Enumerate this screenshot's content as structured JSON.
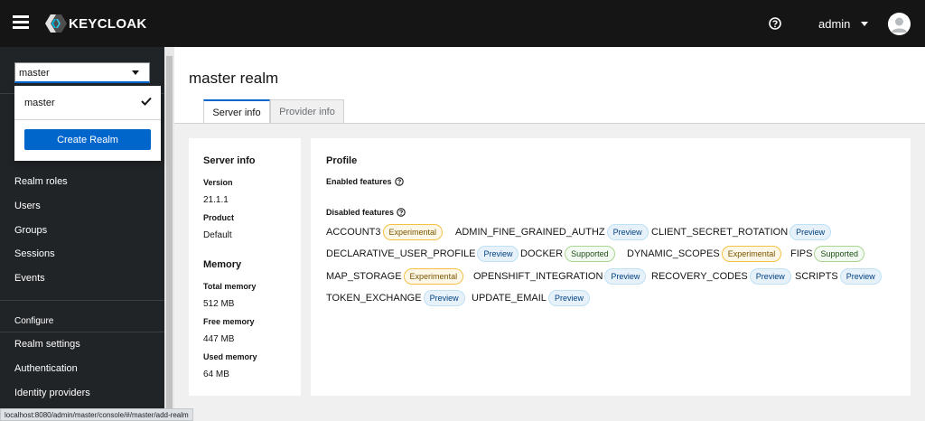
{
  "topbar": {
    "brand": "KEYCLOAK",
    "user_name": "admin",
    "icons": [
      "hamburger-icon",
      "keycloak-logo-icon",
      "help-icon",
      "caret-down-icon",
      "avatar-icon"
    ]
  },
  "realm_selector": {
    "value": "master",
    "options": [
      {
        "label": "master",
        "selected": true
      }
    ],
    "create_label": "Create Realm"
  },
  "sidebar": {
    "items": [
      {
        "label": "Realm roles"
      },
      {
        "label": "Users"
      },
      {
        "label": "Groups"
      },
      {
        "label": "Sessions"
      },
      {
        "label": "Events"
      }
    ],
    "section": "Configure",
    "config_items": [
      {
        "label": "Realm settings"
      },
      {
        "label": "Authentication"
      },
      {
        "label": "Identity providers"
      }
    ]
  },
  "page": {
    "title": "master realm",
    "tabs": [
      {
        "label": "Server info",
        "active": true
      },
      {
        "label": "Provider info",
        "active": false
      }
    ]
  },
  "server_info": {
    "title": "Server info",
    "version_label": "Version",
    "version": "21.1.1",
    "product_label": "Product",
    "product": "Default",
    "memory_title": "Memory",
    "total_label": "Total memory",
    "total": "512 MB",
    "free_label": "Free memory",
    "free": "447 MB",
    "used_label": "Used memory",
    "used": "64 MB"
  },
  "profile": {
    "title": "Profile",
    "enabled_label": "Enabled features",
    "disabled_label": "Disabled features",
    "disabled_features": [
      {
        "name": "ACCOUNT3",
        "badge": "Experimental"
      },
      {
        "name": "ADMIN_FINE_GRAINED_AUTHZ",
        "badge": "Preview"
      },
      {
        "name": "CLIENT_SECRET_ROTATION",
        "badge": "Preview"
      },
      {
        "name": "DECLARATIVE_USER_PROFILE",
        "badge": "Preview"
      },
      {
        "name": "DOCKER",
        "badge": "Supported"
      },
      {
        "name": "DYNAMIC_SCOPES",
        "badge": "Experimental"
      },
      {
        "name": "FIPS",
        "badge": "Supported"
      },
      {
        "name": "MAP_STORAGE",
        "badge": "Experimental"
      },
      {
        "name": "OPENSHIFT_INTEGRATION",
        "badge": "Preview"
      },
      {
        "name": "RECOVERY_CODES",
        "badge": "Preview"
      },
      {
        "name": "SCRIPTS",
        "badge": "Preview"
      },
      {
        "name": "TOKEN_EXCHANGE",
        "badge": "Preview"
      },
      {
        "name": "UPDATE_EMAIL",
        "badge": "Preview"
      }
    ]
  },
  "statusbar": {
    "url": "localhost:8080/admin/master/console/#/master/add-realm"
  },
  "colors": {
    "topbar": "#151515",
    "sidebar": "#212427",
    "accent": "#0066cc"
  }
}
